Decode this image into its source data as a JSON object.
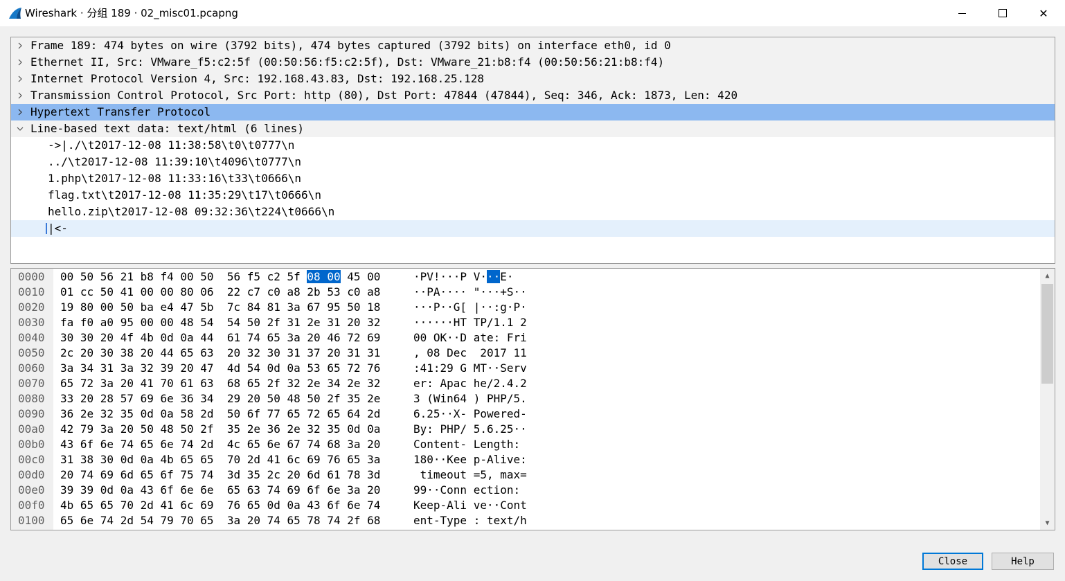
{
  "window": {
    "title": "Wireshark · 分组 189 · 02_misc01.pcapng",
    "controls": {
      "minimize": "—",
      "maximize": "□",
      "close": "✕"
    }
  },
  "tree": {
    "items": [
      {
        "label": "Frame 189: 474 bytes on wire (3792 bits), 474 bytes captured (3792 bits) on interface eth0, id 0",
        "expanded": false
      },
      {
        "label": "Ethernet II, Src: VMware_f5:c2:5f (00:50:56:f5:c2:5f), Dst: VMware_21:b8:f4 (00:50:56:21:b8:f4)",
        "expanded": false
      },
      {
        "label": "Internet Protocol Version 4, Src: 192.168.43.83, Dst: 192.168.25.128",
        "expanded": false
      },
      {
        "label": "Transmission Control Protocol, Src Port: http (80), Dst Port: 47844 (47844), Seq: 346, Ack: 1873, Len: 420",
        "expanded": false
      },
      {
        "label": "Hypertext Transfer Protocol",
        "expanded": false,
        "selected": true
      },
      {
        "label": "Line-based text data: text/html (6 lines)",
        "expanded": true
      }
    ],
    "children": [
      "->|./\\t2017-12-08 11:38:58\\t0\\t0777\\n",
      "../\\t2017-12-08 11:39:10\\t4096\\t0777\\n",
      "1.php\\t2017-12-08 11:33:16\\t33\\t0666\\n",
      "flag.txt\\t2017-12-08 11:35:29\\t17\\t0666\\n",
      "hello.zip\\t2017-12-08 09:32:36\\t224\\t0666\\n",
      "|<-"
    ]
  },
  "hex": {
    "rows": [
      {
        "off": "0000",
        "b1": "00 50 56 21 b8 f4 00 50  56 f5 c2 5f ",
        "hl": "08 00",
        "b2": " 45 00",
        "a1": "·PV!···P V·",
        "ahl": "··",
        "a2": "E·"
      },
      {
        "off": "0010",
        "bytes": "01 cc 50 41 00 00 80 06  22 c7 c0 a8 2b 53 c0 a8",
        "ascii": "··PA···· \"···+S··"
      },
      {
        "off": "0020",
        "bytes": "19 80 00 50 ba e4 47 5b  7c 84 81 3a 67 95 50 18",
        "ascii": "···P··G[ |··:g·P·"
      },
      {
        "off": "0030",
        "bytes": "fa f0 a0 95 00 00 48 54  54 50 2f 31 2e 31 20 32",
        "ascii": "······HT TP/1.1 2"
      },
      {
        "off": "0040",
        "bytes": "30 30 20 4f 4b 0d 0a 44  61 74 65 3a 20 46 72 69",
        "ascii": "00 OK··D ate: Fri"
      },
      {
        "off": "0050",
        "bytes": "2c 20 30 38 20 44 65 63  20 32 30 31 37 20 31 31",
        "ascii": ", 08 Dec  2017 11"
      },
      {
        "off": "0060",
        "bytes": "3a 34 31 3a 32 39 20 47  4d 54 0d 0a 53 65 72 76",
        "ascii": ":41:29 G MT··Serv"
      },
      {
        "off": "0070",
        "bytes": "65 72 3a 20 41 70 61 63  68 65 2f 32 2e 34 2e 32",
        "ascii": "er: Apac he/2.4.2"
      },
      {
        "off": "0080",
        "bytes": "33 20 28 57 69 6e 36 34  29 20 50 48 50 2f 35 2e",
        "ascii": "3 (Win64 ) PHP/5."
      },
      {
        "off": "0090",
        "bytes": "36 2e 32 35 0d 0a 58 2d  50 6f 77 65 72 65 64 2d",
        "ascii": "6.25··X- Powered-"
      },
      {
        "off": "00a0",
        "bytes": "42 79 3a 20 50 48 50 2f  35 2e 36 2e 32 35 0d 0a",
        "ascii": "By: PHP/ 5.6.25··"
      },
      {
        "off": "00b0",
        "bytes": "43 6f 6e 74 65 6e 74 2d  4c 65 6e 67 74 68 3a 20",
        "ascii": "Content- Length: "
      },
      {
        "off": "00c0",
        "bytes": "31 38 30 0d 0a 4b 65 65  70 2d 41 6c 69 76 65 3a",
        "ascii": "180··Kee p-Alive:"
      },
      {
        "off": "00d0",
        "bytes": "20 74 69 6d 65 6f 75 74  3d 35 2c 20 6d 61 78 3d",
        "ascii": " timeout =5, max="
      },
      {
        "off": "00e0",
        "bytes": "39 39 0d 0a 43 6f 6e 6e  65 63 74 69 6f 6e 3a 20",
        "ascii": "99··Conn ection: "
      },
      {
        "off": "00f0",
        "bytes": "4b 65 65 70 2d 41 6c 69  76 65 0d 0a 43 6f 6e 74",
        "ascii": "Keep-Ali ve··Cont"
      },
      {
        "off": "0100",
        "bytes": "65 6e 74 2d 54 79 70 65  3a 20 74 65 78 74 2f 68",
        "ascii": "ent-Type : text/h"
      }
    ]
  },
  "buttons": {
    "close": "Close",
    "help": "Help"
  },
  "colors": {
    "selected_row": "#8cb8f0",
    "hex_highlight": "#0066cc"
  }
}
